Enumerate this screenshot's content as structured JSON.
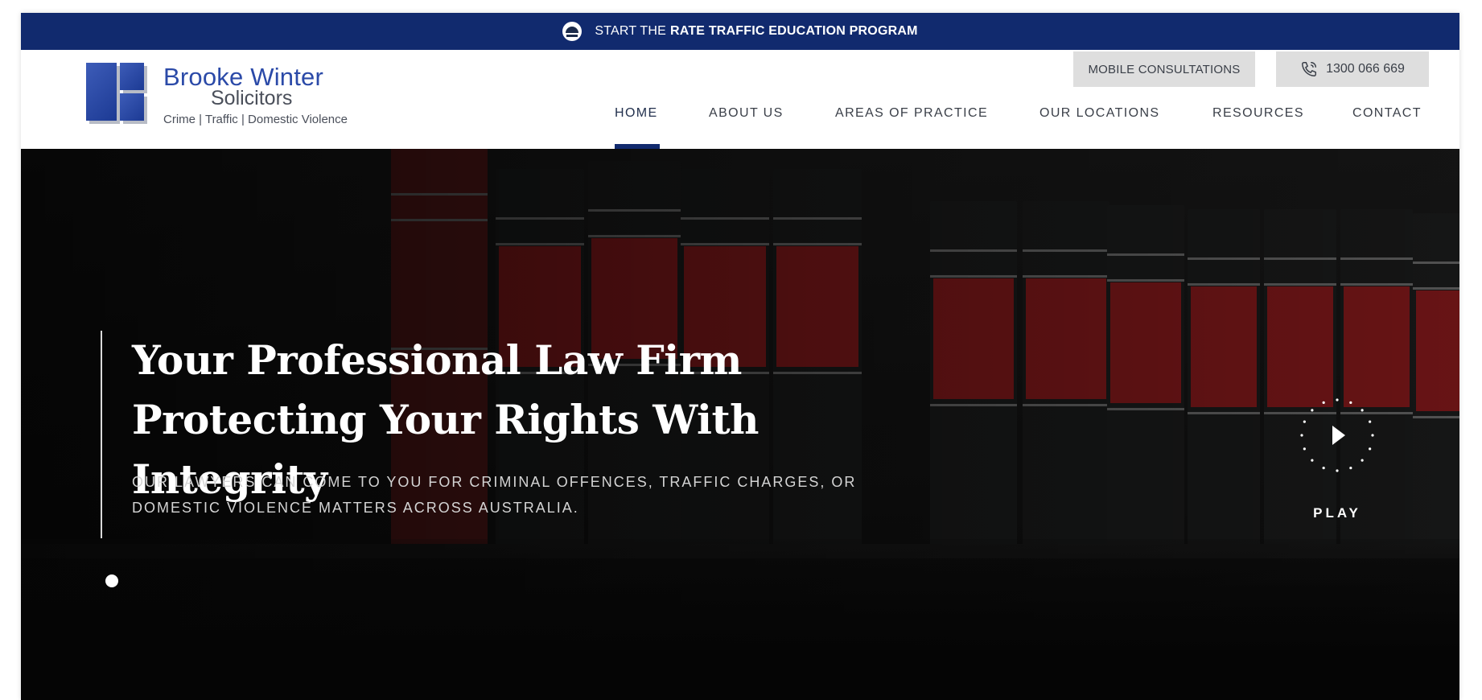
{
  "topbar": {
    "prefix": "START THE",
    "strong": "RATE TRAFFIC EDUCATION PROGRAM",
    "badge_icon": "rate-program-logo-icon",
    "bg_color": "#112a6e"
  },
  "logo": {
    "line1": "Brooke Winter",
    "line2": "Solicitors",
    "tagline": "Crime | Traffic | Domestic Violence",
    "brand_color": "#2b4aa8"
  },
  "header": {
    "mobile_button": "MOBILE CONSULTATIONS",
    "phone": "1300 066 669",
    "phone_icon": "phone-icon"
  },
  "nav": {
    "items": [
      {
        "label": "HOME",
        "active": true
      },
      {
        "label": "ABOUT US",
        "active": false
      },
      {
        "label": "AREAS OF PRACTICE",
        "active": false
      },
      {
        "label": "OUR LOCATIONS",
        "active": false
      },
      {
        "label": "RESOURCES",
        "active": false
      },
      {
        "label": "CONTACT",
        "active": false
      }
    ]
  },
  "hero": {
    "title_line1": "Your Professional Law Firm",
    "title_line2": "Protecting Your Rights With Integrity",
    "subtitle_line1": "OUR LAWYERS CAN COME TO YOU FOR CRIMINAL OFFENCES, TRAFFIC CHARGES, OR",
    "subtitle_line2": "DOMESTIC VIOLENCE MATTERS ACROSS AUSTRALIA.",
    "play_label": "PLAY",
    "play_icon": "play-icon",
    "slider_dots": 1,
    "accent_color": "#8a1a1c"
  }
}
